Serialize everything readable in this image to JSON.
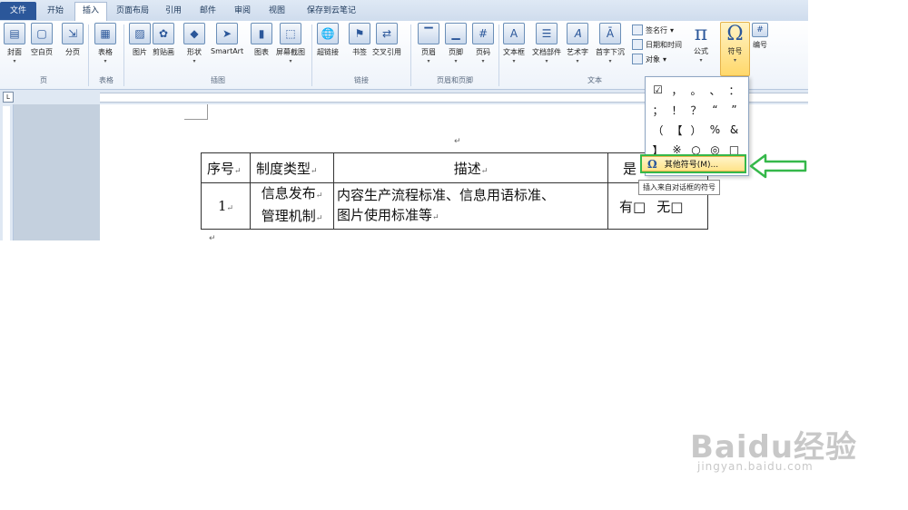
{
  "tabs": [
    {
      "label": "文件"
    },
    {
      "label": "开始"
    },
    {
      "label": "插入"
    },
    {
      "label": "页面布局"
    },
    {
      "label": "引用"
    },
    {
      "label": "邮件"
    },
    {
      "label": "审阅"
    },
    {
      "label": "视图"
    },
    {
      "label": "保存到云笔记"
    }
  ],
  "ribbon": {
    "cover": "封面",
    "blank": "空白页",
    "break": "分页",
    "table": "表格",
    "picture": "图片",
    "clipart": "剪贴画",
    "shapes": "形状",
    "smartart": "SmartArt",
    "chart": "图表",
    "screenshot": "屏幕截图",
    "hyperlink": "超链接",
    "bookmark": "书签",
    "crossref": "交叉引用",
    "header": "页眉",
    "footer": "页脚",
    "pagenum": "页码",
    "textbox": "文本框",
    "quickparts": "文档部件",
    "wordart": "艺术字",
    "dropcap": "首字下沉",
    "signature": "签名行",
    "datetime": "日期和时间",
    "object": "对象",
    "formula": "公式",
    "symbol": "符号",
    "number": "编号",
    "groups": {
      "page": "页",
      "table": "表格",
      "illus": "插图",
      "links": "链接",
      "hf": "页眉和页脚",
      "text": "文本"
    }
  },
  "table": {
    "headers": [
      "序号",
      "制度类型",
      "描述",
      "是"
    ],
    "row": {
      "no": "1",
      "type_line1": "信息发布",
      "type_line2": "管理机制",
      "desc_line1": "内容生产流程标准、信息用语标准、",
      "desc_line2": "图片使用标准等",
      "yes": "有□",
      "no_opt": "无□"
    }
  },
  "symbols": [
    "☑",
    "，",
    "。",
    "、",
    "：",
    "；",
    "！",
    "？",
    "“",
    "”",
    "（",
    "【",
    "）",
    "%",
    "&",
    "】",
    "※",
    "○",
    "◎",
    "□"
  ],
  "menu": {
    "more_symbols": "其他符号(M)...",
    "tooltip": "插入来自对话框的符号"
  },
  "watermark": {
    "logo": "Baidu经验",
    "url": "jingyan.baidu.com"
  }
}
